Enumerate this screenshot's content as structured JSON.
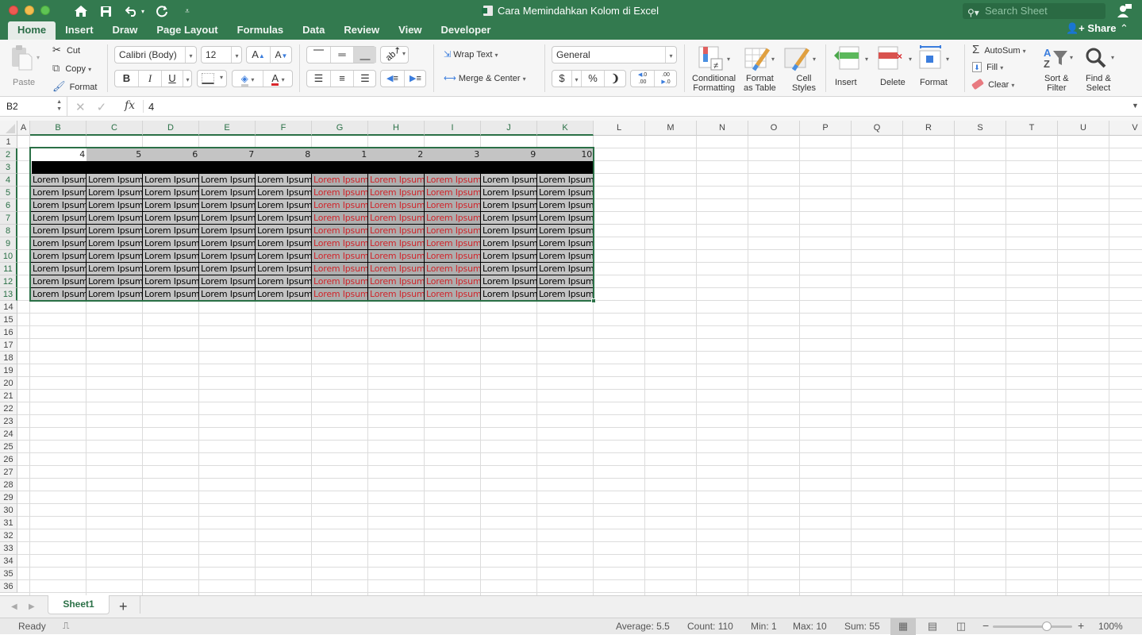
{
  "window": {
    "title": "Cara Memindahkan Kolom di Excel",
    "search_placeholder": "Search Sheet"
  },
  "ribbon_tabs": [
    {
      "label": "Home",
      "active": true
    },
    {
      "label": "Insert"
    },
    {
      "label": "Draw"
    },
    {
      "label": "Page Layout"
    },
    {
      "label": "Formulas"
    },
    {
      "label": "Data"
    },
    {
      "label": "Review"
    },
    {
      "label": "View"
    },
    {
      "label": "Developer"
    }
  ],
  "share_label": "Share",
  "clipboard": {
    "paste": "Paste",
    "cut": "Cut",
    "copy": "Copy",
    "format": "Format"
  },
  "font": {
    "name": "Calibri (Body)",
    "size": "12",
    "bold": "B",
    "italic": "I",
    "underline": "U"
  },
  "alignment": {
    "wrap_text": "Wrap Text",
    "merge_center": "Merge & Center"
  },
  "number": {
    "format": "General",
    "currency": "$",
    "percent": "%",
    "comma": "❩",
    "inc_decimal": ".0 .00",
    "dec_decimal": ".00 .0"
  },
  "styles": {
    "conditional": [
      "Conditional",
      "Formatting"
    ],
    "format_table": [
      "Format",
      "as Table"
    ],
    "cell_styles": [
      "Cell",
      "Styles"
    ]
  },
  "cells": {
    "insert": "Insert",
    "delete": "Delete",
    "format": "Format"
  },
  "editing": {
    "autosum": "AutoSum",
    "fill": "Fill",
    "clear": "Clear",
    "sort": [
      "Sort &",
      "Filter"
    ],
    "find": [
      "Find &",
      "Select"
    ]
  },
  "formula_bar": {
    "name_box": "B2",
    "fx": "fx",
    "value": "4"
  },
  "columns": [
    "A",
    "B",
    "C",
    "D",
    "E",
    "F",
    "G",
    "H",
    "I",
    "J",
    "K",
    "L",
    "M",
    "N",
    "O",
    "P",
    "Q",
    "R",
    "S",
    "T",
    "U",
    "V"
  ],
  "selected_columns": [
    "B",
    "C",
    "D",
    "E",
    "F",
    "G",
    "H",
    "I",
    "J",
    "K"
  ],
  "rows": [
    "1",
    "2",
    "3",
    "4",
    "5",
    "6",
    "7",
    "8",
    "9",
    "10",
    "11",
    "12",
    "13",
    "14",
    "15",
    "16",
    "17",
    "18",
    "19",
    "20",
    "21",
    "22",
    "23",
    "24",
    "25",
    "26",
    "27",
    "28",
    "29",
    "30",
    "31",
    "32",
    "33",
    "34",
    "35",
    "36"
  ],
  "selected_rows": [
    "2",
    "3",
    "4",
    "5",
    "6",
    "7",
    "8",
    "9",
    "10",
    "11",
    "12",
    "13"
  ],
  "sheet": {
    "row2_values": [
      "4",
      "5",
      "6",
      "7",
      "8",
      "1",
      "2",
      "3",
      "9",
      "10"
    ],
    "data_text": "Lorem Ipsum",
    "data_rows": 10,
    "red_columns": [
      "G",
      "H",
      "I"
    ],
    "colors": {
      "header_fill": "#c4c4c4",
      "data_fill": "#c4c4c4",
      "red_col_fill": "#aeaeae",
      "red_text": "#d0242a",
      "row3_fill": "#000000",
      "selection": "#2a7046"
    }
  },
  "sheet_tabs": [
    {
      "label": "Sheet1",
      "active": true
    }
  ],
  "status": {
    "mode": "Ready",
    "average": "Average: 5.5",
    "count": "Count: 110",
    "min": "Min: 1",
    "max": "Max: 10",
    "sum": "Sum: 55",
    "zoom": "100%",
    "zoom_percent": 100
  },
  "theme": {
    "brand": "#337a4f"
  }
}
